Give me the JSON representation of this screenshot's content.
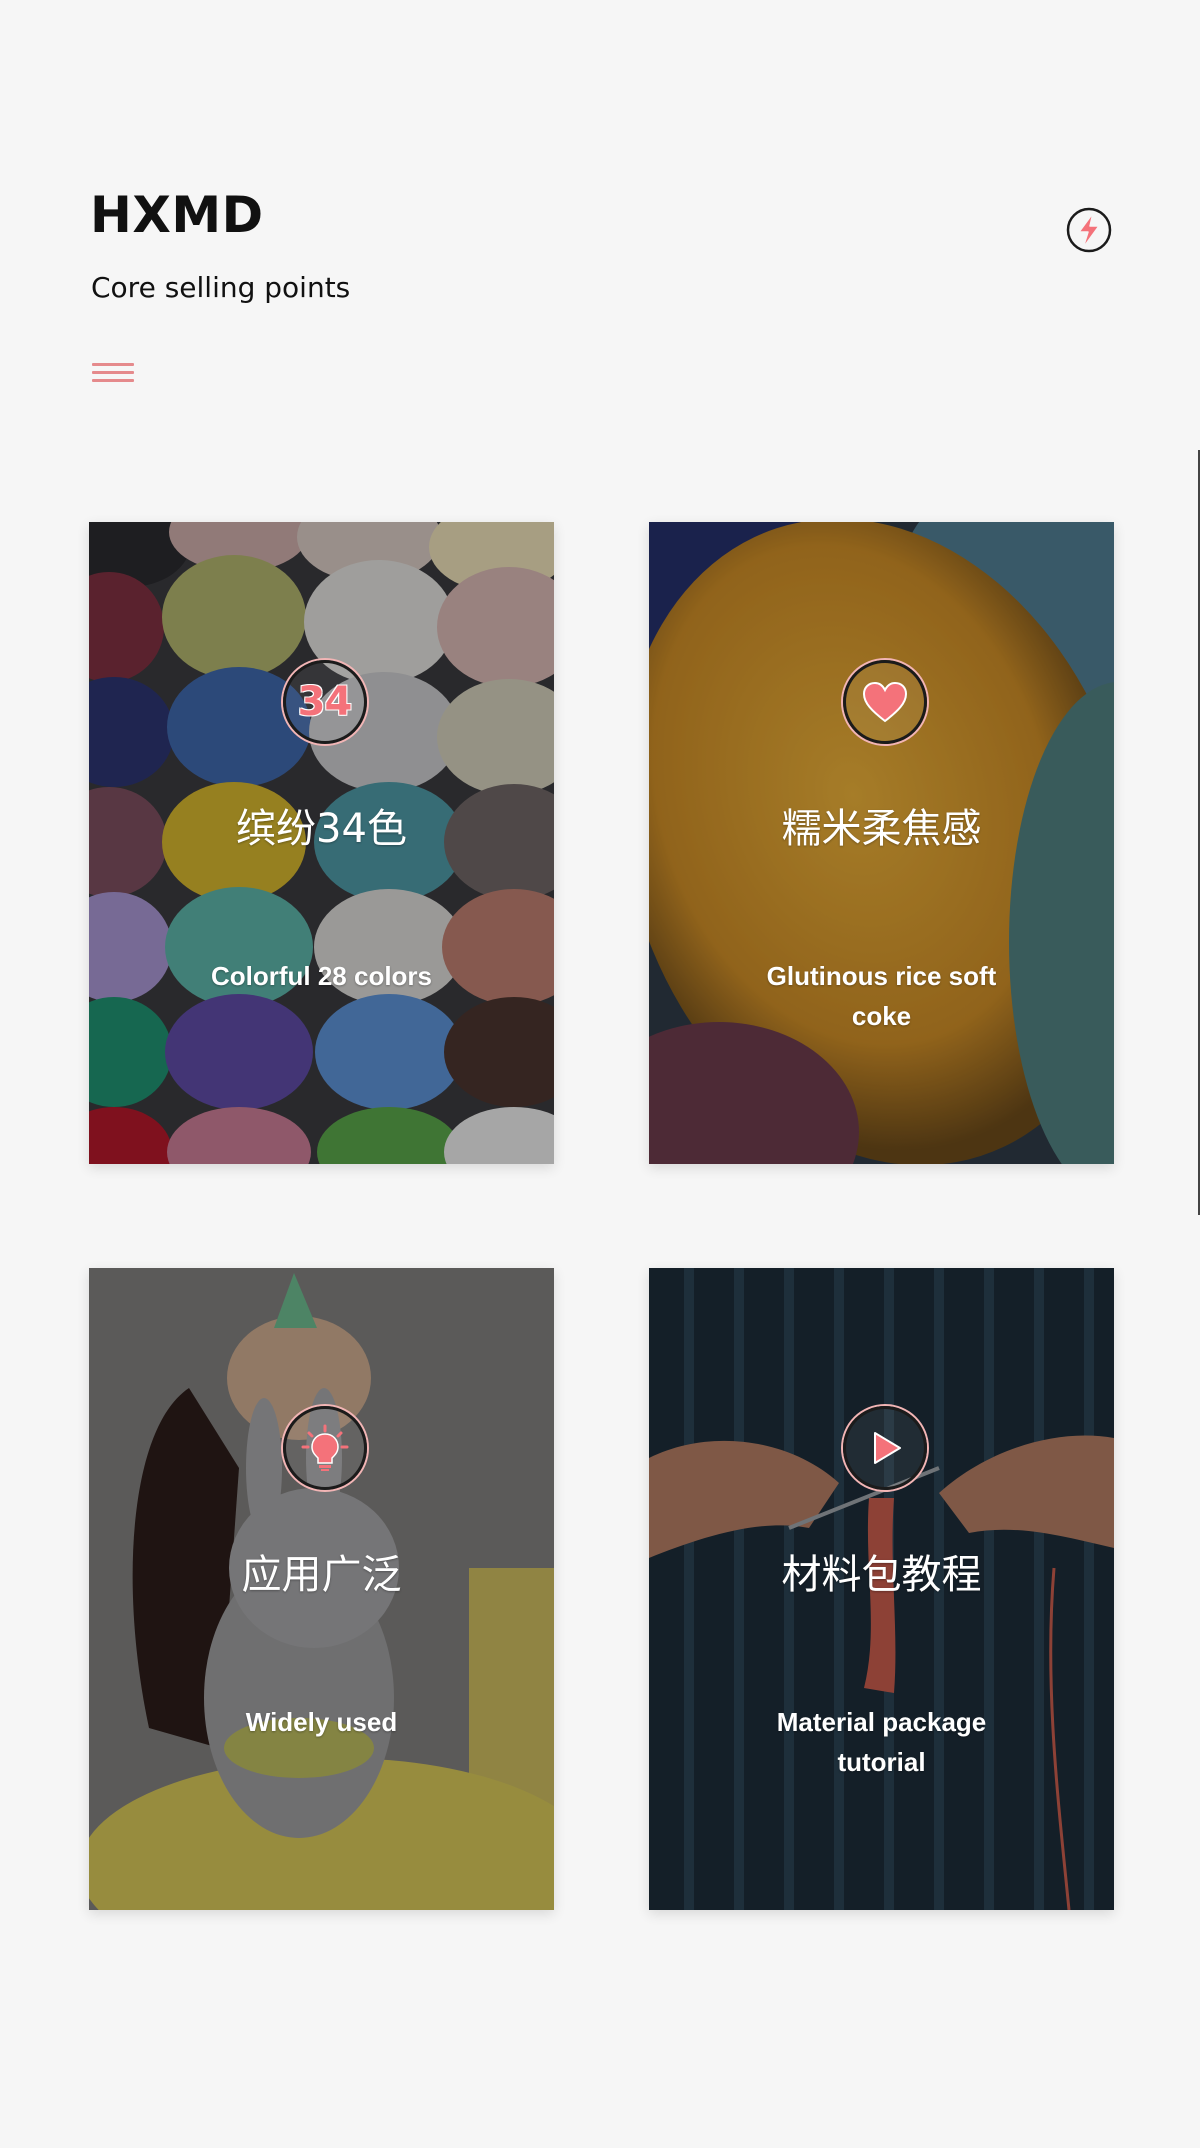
{
  "header": {
    "brand": "HXMD",
    "subtitle": "Core selling points",
    "menu_icon": "hamburger-menu-icon",
    "action_icon": "lightning-bolt-icon"
  },
  "colors": {
    "accent": "#f4727a",
    "accent_light": "#f2b5b5",
    "background": "#f6f6f6",
    "text": "#111111"
  },
  "cards": [
    {
      "icon": "number-badge-icon",
      "icon_text": "34",
      "title": "缤纷34色",
      "description": "Colorful 28 colors"
    },
    {
      "icon": "heart-icon",
      "title": "糯米柔焦感",
      "description": "Glutinous rice soft coke"
    },
    {
      "icon": "lightbulb-icon",
      "title": "应用广泛",
      "description": "Widely used"
    },
    {
      "icon": "play-icon",
      "title": "材料包教程",
      "description": "Material package tutorial"
    }
  ]
}
